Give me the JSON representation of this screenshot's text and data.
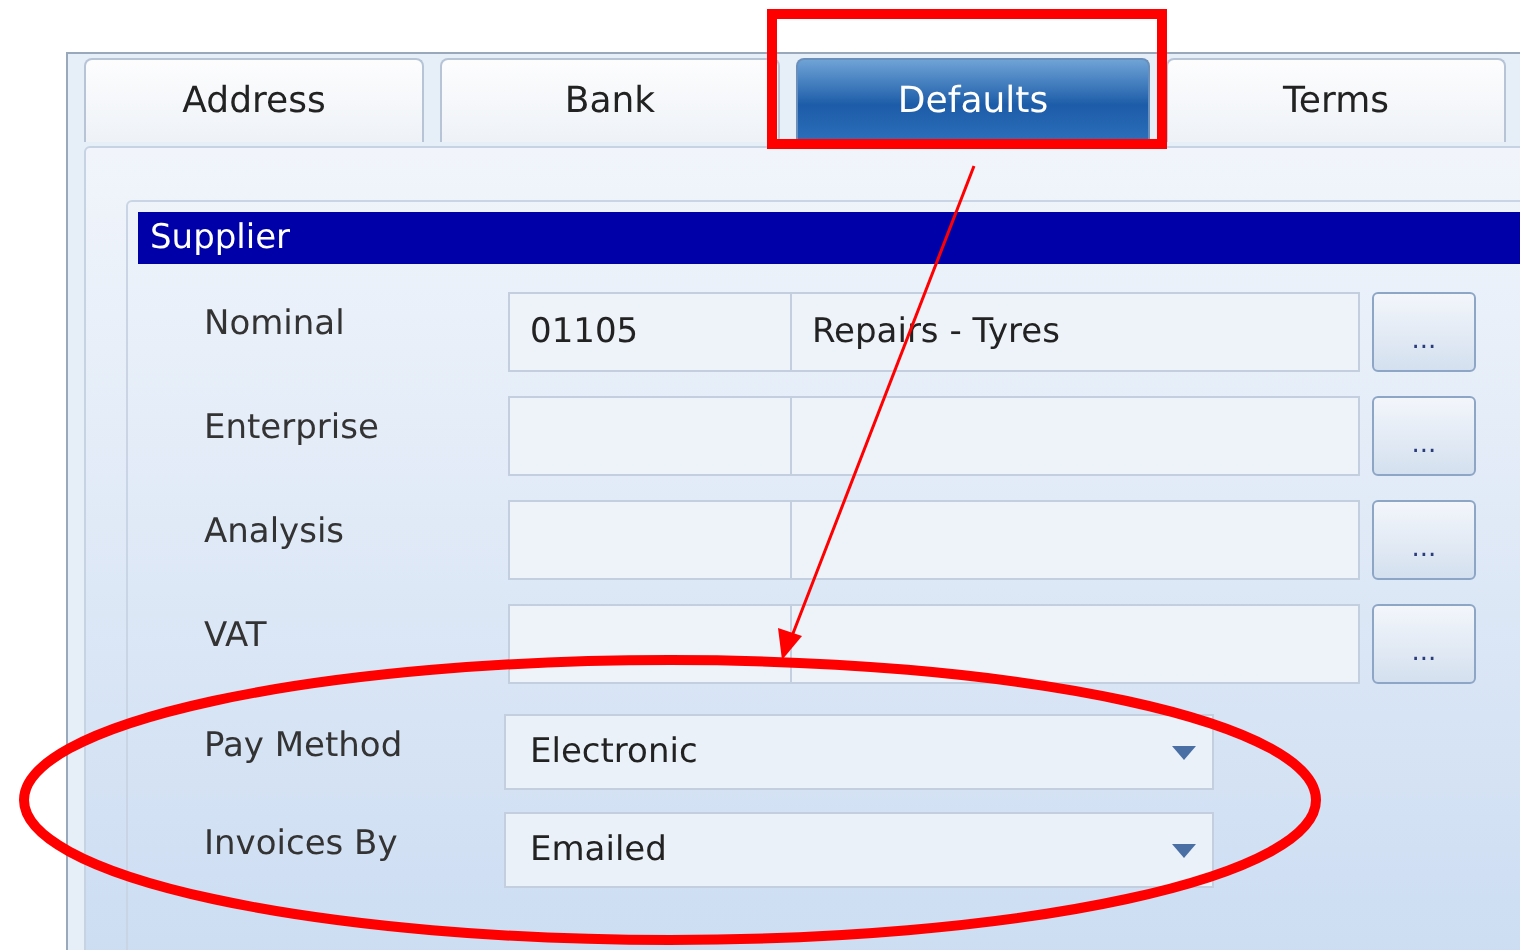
{
  "tabs": [
    {
      "label": "Address",
      "selected": false
    },
    {
      "label": "Bank",
      "selected": false
    },
    {
      "label": "Defaults",
      "selected": true
    },
    {
      "label": "Terms",
      "selected": false
    }
  ],
  "group": {
    "title": "Supplier"
  },
  "lookup_rows": [
    {
      "label": "Nominal",
      "code": "01105",
      "name": "Repairs - Tyres",
      "button": "..."
    },
    {
      "label": "Enterprise",
      "button": "..."
    },
    {
      "label": "Analysis",
      "button": "..."
    },
    {
      "label": "VAT",
      "button": "..."
    }
  ],
  "dropdown_rows": [
    {
      "label": "Pay Method",
      "value": "Electronic"
    },
    {
      "label": "Invoices By",
      "value": "Emailed"
    }
  ]
}
